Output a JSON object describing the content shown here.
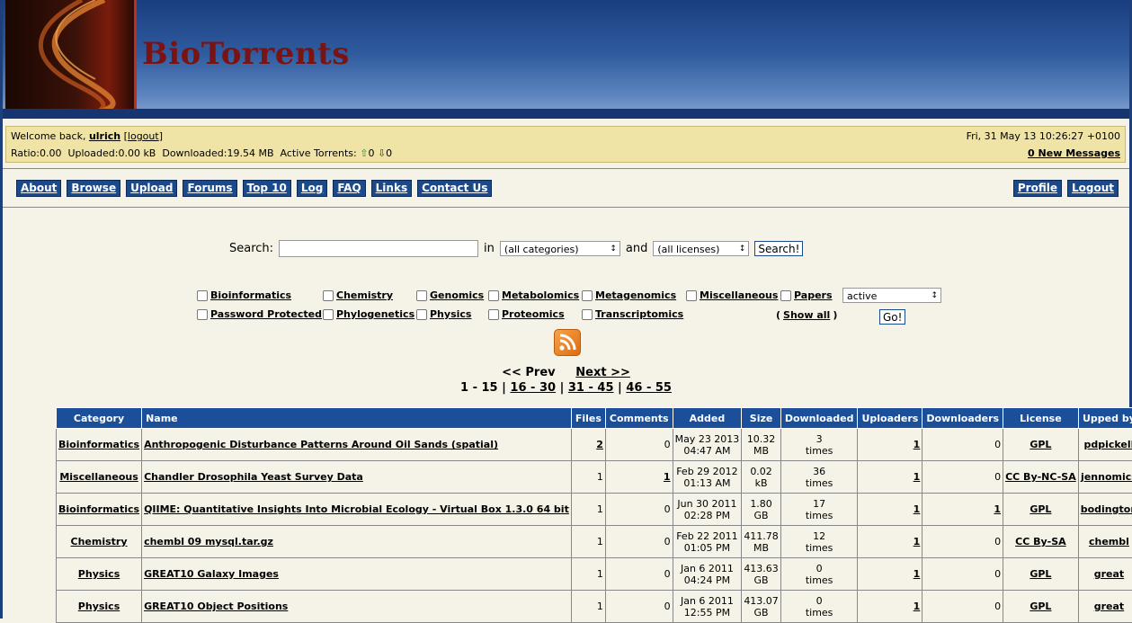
{
  "site": {
    "title": "BioTorrents"
  },
  "status": {
    "welcome": "Welcome back,",
    "user": "ulrich",
    "logout": "logout",
    "ratio": "Ratio:0.00",
    "uploaded": "Uploaded:0.00 kB",
    "downloaded": "Downloaded:19.54 MB",
    "active_label": "Active Torrents:",
    "active_up": "0",
    "active_down": "0",
    "datetime": "Fri, 31 May 13 10:26:27 +0100",
    "messages": "0 New Messages"
  },
  "nav": {
    "left": [
      "About",
      "Browse",
      "Upload",
      "Forums",
      "Top 10",
      "Log",
      "FAQ",
      "Links",
      "Contact Us"
    ],
    "right": [
      "Profile",
      "Logout"
    ]
  },
  "search": {
    "label": "Search:",
    "value": "",
    "in_label": "in",
    "category_selected": "(all categories)",
    "and_label": "and",
    "license_selected": "(all licenses)",
    "button": "Search!"
  },
  "filters": {
    "row1": [
      "Bioinformatics",
      "Chemistry",
      "Genomics",
      "Metabolomics",
      "Metagenomics",
      "Miscellaneous",
      "Papers"
    ],
    "row2": [
      "Password Protected",
      "Phylogenetics",
      "Physics",
      "Proteomics",
      "Transcriptomics"
    ],
    "show_all": "Show all",
    "status_selected": "active",
    "go": "Go!"
  },
  "pager": {
    "prev": "<< Prev",
    "next": "Next >>",
    "pages": [
      "1 - 15",
      "16 - 30",
      "31 - 45",
      "46 - 55"
    ]
  },
  "table": {
    "headers": [
      "Category",
      "Name",
      "Files",
      "Comments",
      "Added",
      "Size",
      "Downloaded",
      "Uploaders",
      "Downloaders",
      "License",
      "Upped by"
    ],
    "rows": [
      {
        "category": "Bioinformatics",
        "name": "Anthropogenic Disturbance Patterns Around Oil Sands (spatial)",
        "files": "2",
        "comments": "0",
        "added1": "May 23 2013",
        "added2": "04:47 AM",
        "size1": "10.32",
        "size2": "MB",
        "dl1": "3",
        "dl2": "times",
        "uploaders": "1",
        "downloaders": "0",
        "license": "GPL",
        "upped_by": "pdpickell"
      },
      {
        "category": "Miscellaneous",
        "name": "Chandler Drosophila Yeast Survey Data",
        "files": "1",
        "comments": "1",
        "added1": "Feb 29 2012",
        "added2": "01:13 AM",
        "size1": "0.02",
        "size2": "kB",
        "dl1": "36",
        "dl2": "times",
        "uploaders": "1",
        "downloaders": "0",
        "license": "CC By-NC-SA",
        "upped_by": "jennomics"
      },
      {
        "category": "Bioinformatics",
        "name": "QIIME: Quantitative Insights Into Microbial Ecology - Virtual Box 1.3.0 64 bit",
        "files": "1",
        "comments": "0",
        "added1": "Jun 30 2011",
        "added2": "02:28 PM",
        "size1": "1.80",
        "size2": "GB",
        "dl1": "17",
        "dl2": "times",
        "uploaders": "1",
        "downloaders": "1",
        "license": "GPL",
        "upped_by": "bodington"
      },
      {
        "category": "Chemistry",
        "name": "chembl 09 mysql.tar.gz",
        "files": "1",
        "comments": "0",
        "added1": "Feb 22 2011",
        "added2": "01:05 PM",
        "size1": "411.78",
        "size2": "MB",
        "dl1": "12",
        "dl2": "times",
        "uploaders": "1",
        "downloaders": "0",
        "license": "CC By-SA",
        "upped_by": "chembl"
      },
      {
        "category": "Physics",
        "name": "GREAT10 Galaxy Images",
        "files": "1",
        "comments": "0",
        "added1": "Jan 6 2011",
        "added2": "04:24 PM",
        "size1": "413.63",
        "size2": "GB",
        "dl1": "0",
        "dl2": "times",
        "uploaders": "1",
        "downloaders": "0",
        "license": "GPL",
        "upped_by": "great"
      },
      {
        "category": "Physics",
        "name": "GREAT10 Object Positions",
        "files": "1",
        "comments": "0",
        "added1": "Jan 6 2011",
        "added2": "12:55 PM",
        "size1": "413.07",
        "size2": "GB",
        "dl1": "0",
        "dl2": "times",
        "uploaders": "1",
        "downloaders": "0",
        "license": "GPL",
        "upped_by": "great"
      }
    ]
  }
}
